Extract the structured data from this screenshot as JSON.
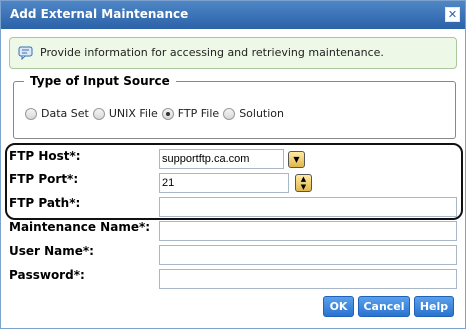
{
  "dialog": {
    "title": "Add External Maintenance",
    "close_glyph": "✕"
  },
  "info": {
    "icon": "message-icon",
    "text": "Provide information for accessing and retrieving maintenance."
  },
  "input_source": {
    "legend": "Type of Input Source",
    "options": [
      {
        "label": "Data Set",
        "checked": false
      },
      {
        "label": "UNIX File",
        "checked": false
      },
      {
        "label": "FTP File",
        "checked": true
      },
      {
        "label": "Solution",
        "checked": false
      }
    ]
  },
  "fields": {
    "ftp_host": {
      "label": "FTP Host*:",
      "value": "supportftp.ca.com"
    },
    "ftp_port": {
      "label": "FTP Port*:",
      "value": "21"
    },
    "ftp_path": {
      "label": "FTP Path*:",
      "value": ""
    },
    "maintenance_name": {
      "label": "Maintenance Name*:",
      "value": ""
    },
    "user_name": {
      "label": "User Name*:",
      "value": ""
    },
    "password": {
      "label": "Password*:",
      "value": ""
    }
  },
  "buttons": {
    "ok": "OK",
    "cancel": "Cancel",
    "help": "Help"
  },
  "colors": {
    "title_bar": "#2b62a8",
    "button": "#2a73cf",
    "info_bg": "#eef8e6"
  }
}
